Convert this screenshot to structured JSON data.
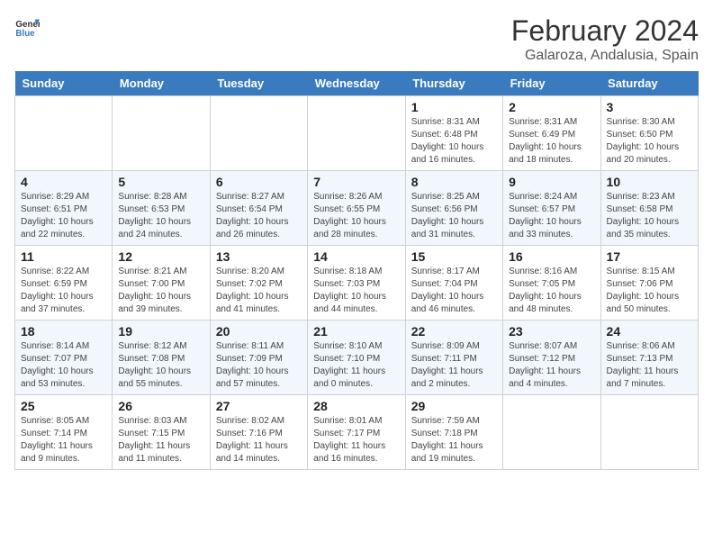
{
  "header": {
    "logo_general": "General",
    "logo_blue": "Blue",
    "month_title": "February 2024",
    "location": "Galaroza, Andalusia, Spain"
  },
  "days_of_week": [
    "Sunday",
    "Monday",
    "Tuesday",
    "Wednesday",
    "Thursday",
    "Friday",
    "Saturday"
  ],
  "weeks": [
    [
      {
        "day": "",
        "info": ""
      },
      {
        "day": "",
        "info": ""
      },
      {
        "day": "",
        "info": ""
      },
      {
        "day": "",
        "info": ""
      },
      {
        "day": "1",
        "info": "Sunrise: 8:31 AM\nSunset: 6:48 PM\nDaylight: 10 hours and 16 minutes."
      },
      {
        "day": "2",
        "info": "Sunrise: 8:31 AM\nSunset: 6:49 PM\nDaylight: 10 hours and 18 minutes."
      },
      {
        "day": "3",
        "info": "Sunrise: 8:30 AM\nSunset: 6:50 PM\nDaylight: 10 hours and 20 minutes."
      }
    ],
    [
      {
        "day": "4",
        "info": "Sunrise: 8:29 AM\nSunset: 6:51 PM\nDaylight: 10 hours and 22 minutes."
      },
      {
        "day": "5",
        "info": "Sunrise: 8:28 AM\nSunset: 6:53 PM\nDaylight: 10 hours and 24 minutes."
      },
      {
        "day": "6",
        "info": "Sunrise: 8:27 AM\nSunset: 6:54 PM\nDaylight: 10 hours and 26 minutes."
      },
      {
        "day": "7",
        "info": "Sunrise: 8:26 AM\nSunset: 6:55 PM\nDaylight: 10 hours and 28 minutes."
      },
      {
        "day": "8",
        "info": "Sunrise: 8:25 AM\nSunset: 6:56 PM\nDaylight: 10 hours and 31 minutes."
      },
      {
        "day": "9",
        "info": "Sunrise: 8:24 AM\nSunset: 6:57 PM\nDaylight: 10 hours and 33 minutes."
      },
      {
        "day": "10",
        "info": "Sunrise: 8:23 AM\nSunset: 6:58 PM\nDaylight: 10 hours and 35 minutes."
      }
    ],
    [
      {
        "day": "11",
        "info": "Sunrise: 8:22 AM\nSunset: 6:59 PM\nDaylight: 10 hours and 37 minutes."
      },
      {
        "day": "12",
        "info": "Sunrise: 8:21 AM\nSunset: 7:00 PM\nDaylight: 10 hours and 39 minutes."
      },
      {
        "day": "13",
        "info": "Sunrise: 8:20 AM\nSunset: 7:02 PM\nDaylight: 10 hours and 41 minutes."
      },
      {
        "day": "14",
        "info": "Sunrise: 8:18 AM\nSunset: 7:03 PM\nDaylight: 10 hours and 44 minutes."
      },
      {
        "day": "15",
        "info": "Sunrise: 8:17 AM\nSunset: 7:04 PM\nDaylight: 10 hours and 46 minutes."
      },
      {
        "day": "16",
        "info": "Sunrise: 8:16 AM\nSunset: 7:05 PM\nDaylight: 10 hours and 48 minutes."
      },
      {
        "day": "17",
        "info": "Sunrise: 8:15 AM\nSunset: 7:06 PM\nDaylight: 10 hours and 50 minutes."
      }
    ],
    [
      {
        "day": "18",
        "info": "Sunrise: 8:14 AM\nSunset: 7:07 PM\nDaylight: 10 hours and 53 minutes."
      },
      {
        "day": "19",
        "info": "Sunrise: 8:12 AM\nSunset: 7:08 PM\nDaylight: 10 hours and 55 minutes."
      },
      {
        "day": "20",
        "info": "Sunrise: 8:11 AM\nSunset: 7:09 PM\nDaylight: 10 hours and 57 minutes."
      },
      {
        "day": "21",
        "info": "Sunrise: 8:10 AM\nSunset: 7:10 PM\nDaylight: 11 hours and 0 minutes."
      },
      {
        "day": "22",
        "info": "Sunrise: 8:09 AM\nSunset: 7:11 PM\nDaylight: 11 hours and 2 minutes."
      },
      {
        "day": "23",
        "info": "Sunrise: 8:07 AM\nSunset: 7:12 PM\nDaylight: 11 hours and 4 minutes."
      },
      {
        "day": "24",
        "info": "Sunrise: 8:06 AM\nSunset: 7:13 PM\nDaylight: 11 hours and 7 minutes."
      }
    ],
    [
      {
        "day": "25",
        "info": "Sunrise: 8:05 AM\nSunset: 7:14 PM\nDaylight: 11 hours and 9 minutes."
      },
      {
        "day": "26",
        "info": "Sunrise: 8:03 AM\nSunset: 7:15 PM\nDaylight: 11 hours and 11 minutes."
      },
      {
        "day": "27",
        "info": "Sunrise: 8:02 AM\nSunset: 7:16 PM\nDaylight: 11 hours and 14 minutes."
      },
      {
        "day": "28",
        "info": "Sunrise: 8:01 AM\nSunset: 7:17 PM\nDaylight: 11 hours and 16 minutes."
      },
      {
        "day": "29",
        "info": "Sunrise: 7:59 AM\nSunset: 7:18 PM\nDaylight: 11 hours and 19 minutes."
      },
      {
        "day": "",
        "info": ""
      },
      {
        "day": "",
        "info": ""
      }
    ]
  ]
}
